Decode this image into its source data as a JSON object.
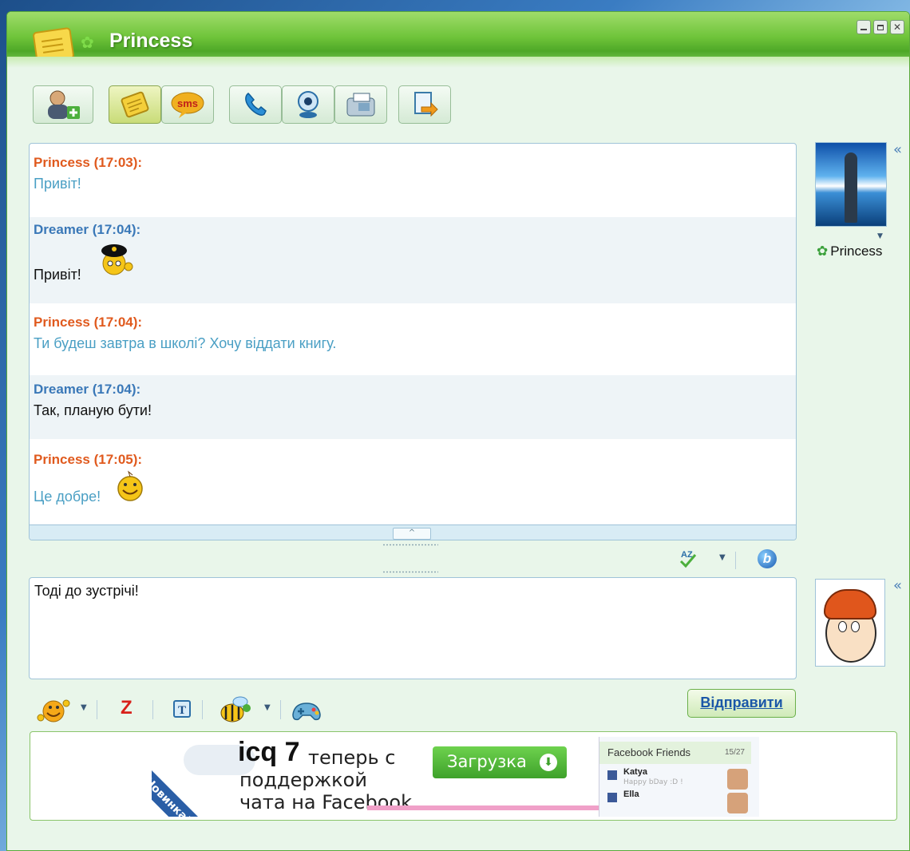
{
  "window": {
    "title": "Princess",
    "controls": [
      "minimize",
      "maximize",
      "close"
    ]
  },
  "toolbar": {
    "buttons": [
      {
        "name": "add-contact",
        "icon": "add-user-icon"
      },
      {
        "name": "message",
        "icon": "note-icon",
        "active": true
      },
      {
        "name": "sms",
        "icon": "sms-icon",
        "label": "sms"
      },
      {
        "name": "call",
        "icon": "phone-icon"
      },
      {
        "name": "video",
        "icon": "webcam-icon"
      },
      {
        "name": "fax",
        "icon": "fax-icon"
      },
      {
        "name": "file-transfer",
        "icon": "file-transfer-icon"
      }
    ]
  },
  "chat": {
    "messages": [
      {
        "sender": "Princess (17:03):",
        "text": "Привіт!",
        "who": "princess"
      },
      {
        "sender": "Dreamer (17:04):",
        "text": "Привіт!",
        "who": "dreamer",
        "emoticon": "police-smiley"
      },
      {
        "sender": "Princess (17:04):",
        "text": "Ти будеш завтра в школі? Хочу віддати книгу.",
        "who": "princess"
      },
      {
        "sender": "Dreamer (17:04):",
        "text": "Так, планую бути!",
        "who": "dreamer"
      },
      {
        "sender": "Princess (17:05):",
        "text": "Це добре!",
        "who": "princess",
        "emoticon": "smiley"
      }
    ],
    "collapse_label": "^"
  },
  "contact": {
    "name": "Princess",
    "expand_label": "«"
  },
  "input": {
    "value": "Тоді до зустрічі!",
    "expand_label": "«"
  },
  "format_tools": {
    "spellcheck_icon": "spellcheck-icon",
    "bold_label": "b"
  },
  "bottom_tools": {
    "z_label": "Z",
    "t_label": "T"
  },
  "send_label": "Відправити",
  "ad": {
    "ribbon": "Новинка!",
    "logo": "icq 7",
    "line1": "теперь с",
    "line2": "поддержкой",
    "line3": "чата на Facebook",
    "download": "Загрузка",
    "fb_title": "Facebook Friends",
    "fb_count": "15/27",
    "fb_friend1": "Katya",
    "fb_friend1_status": "Happy bDay :D !",
    "fb_friend2": "Ella"
  },
  "colors": {
    "title_green": "#6fc43a",
    "princess_name": "#e05a1e",
    "dreamer_name": "#3a78b8",
    "princess_text": "#4a9fc4",
    "send_text": "#1b57a8"
  }
}
